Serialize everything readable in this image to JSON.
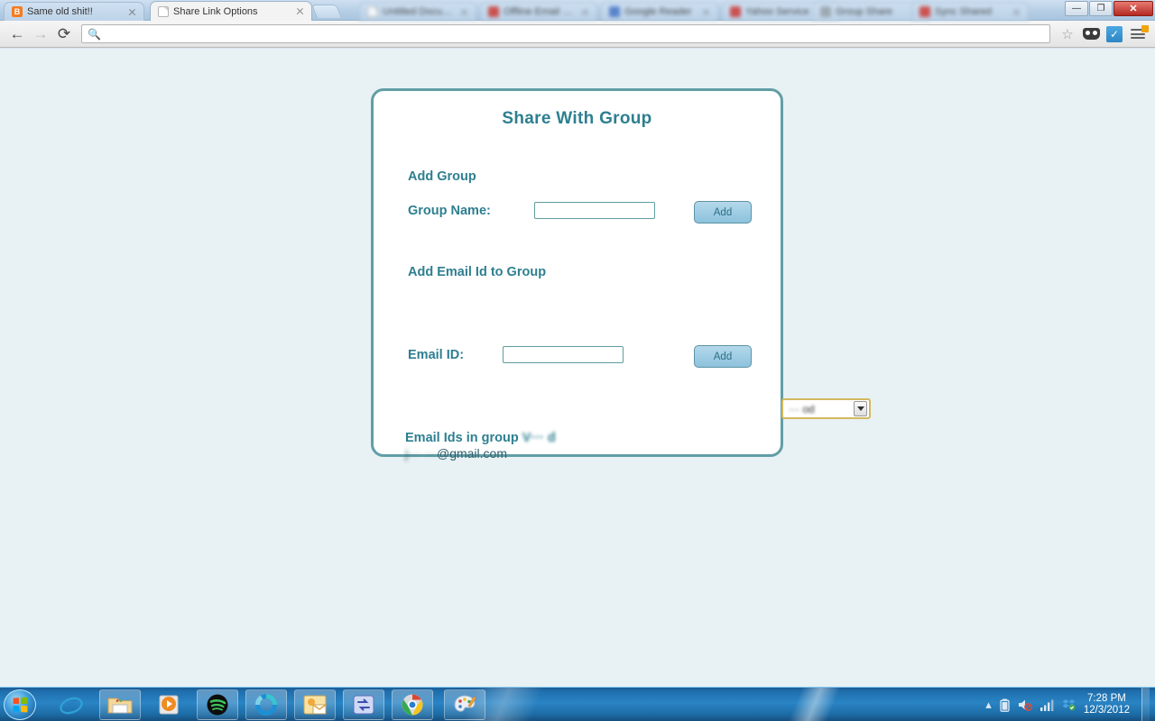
{
  "window": {
    "controls": {
      "minimize": "—",
      "maximize": "❐",
      "close": "✕"
    }
  },
  "tabs": [
    {
      "title": "Same old shit!!",
      "favicon": "blogger-icon",
      "active": false,
      "blurred": false
    },
    {
      "title": "Share Link Options",
      "favicon": "document-icon",
      "active": true,
      "blurred": false
    },
    {
      "title": "Untitled Document",
      "favicon": "document-icon",
      "active": false,
      "blurred": true
    },
    {
      "title": "Offline Email Reader",
      "favicon": "red-app-icon",
      "active": false,
      "blurred": true
    },
    {
      "title": "Google Reader",
      "favicon": "reader-icon",
      "active": false,
      "blurred": true
    },
    {
      "title": "Yahoo Service",
      "favicon": "red-app-icon",
      "active": false,
      "blurred": true
    },
    {
      "title": "Group Share",
      "favicon": "gray-app-icon",
      "active": false,
      "blurred": true
    },
    {
      "title": "Sync Shared",
      "favicon": "red-app-icon",
      "active": false,
      "blurred": true
    }
  ],
  "toolbar": {
    "back_icon": "back-arrow-icon",
    "forward_icon": "forward-arrow-icon",
    "reload_icon": "reload-icon",
    "search_icon": "search-icon",
    "omnibox_value": "",
    "omnibox_placeholder": "",
    "bookmark_icon": "star-icon",
    "extension_mask": "mask-extension-icon",
    "extension_check": "checkmark-extension-icon",
    "menu_icon": "hamburger-menu-icon"
  },
  "page": {
    "title": "Share With Group",
    "add_group_heading": "Add Group",
    "group_name_label": "Group Name:",
    "group_name_value": "",
    "group_add_button": "Add",
    "add_email_heading": "Add Email Id to Group",
    "group_select_value": "··· od",
    "group_select_arrow": "chevron-down-icon",
    "email_id_label": "Email ID:",
    "email_id_value": "",
    "email_add_button": "Add",
    "group_members_prefix": "Email Ids in group ",
    "group_members_name": "V··· d",
    "member_email_user": "j··· ···",
    "member_email_domain": "@gmail.com"
  },
  "taskbar": {
    "start_button": "start-button",
    "items": [
      {
        "name": "internet-explorer",
        "glyph": "e"
      },
      {
        "name": "windows-explorer",
        "glyph": ""
      },
      {
        "name": "windows-media-player",
        "glyph": "▶"
      },
      {
        "name": "spotify",
        "glyph": ""
      },
      {
        "name": "ring-app",
        "glyph": ""
      },
      {
        "name": "contacts-mail-app",
        "glyph": ""
      },
      {
        "name": "blue-sync-app",
        "glyph": "⇄"
      },
      {
        "name": "google-chrome",
        "glyph": ""
      },
      {
        "name": "paint",
        "glyph": ""
      }
    ],
    "tray": {
      "show_hidden_icon": "chevron-up-icon",
      "battery_icon": "battery-icon",
      "volume_icon": "volume-muted-icon",
      "network_icon": "signal-bars-icon",
      "dropbox_icon": "dropbox-icon",
      "time": "7:28 PM",
      "date": "12/3/2012"
    }
  },
  "colors": {
    "accent_teal": "#2d7f90",
    "card_border": "#629ea6",
    "page_background": "#e8f1f3",
    "button_blue": "#9fcde4",
    "select_highlight": "#d4b95e"
  }
}
